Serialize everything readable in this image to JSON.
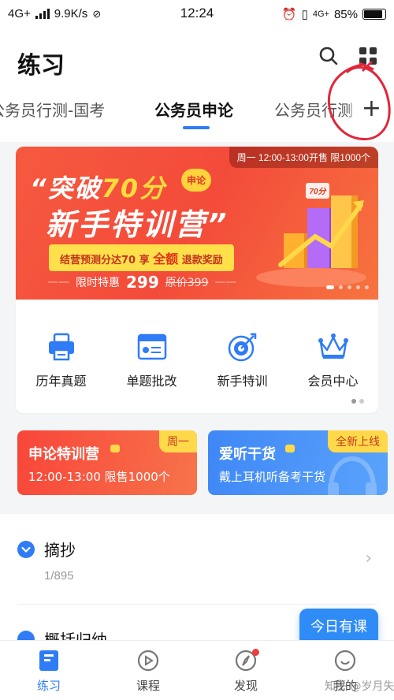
{
  "status_bar": {
    "network": "4G+",
    "speed": "9.9K/s",
    "time": "12:24",
    "network_right": "4G+",
    "battery": "85%"
  },
  "header": {
    "title": "练习",
    "tabs": [
      {
        "label": "公务员行测-国考",
        "active": false
      },
      {
        "label": "公务员申论",
        "active": true
      },
      {
        "label": "公务员行测",
        "active": false
      }
    ],
    "add_label": "+"
  },
  "banner": {
    "tag": "周一  12:00-13:00开售 限1000个",
    "line1_a": "“突破",
    "line1_b": "70分",
    "badge": "申论",
    "line2": "新手特训营”",
    "pill_a": "结营预测分达70  享",
    "pill_b": "全额",
    "pill_c": "退款奖励",
    "price_label": "限时特惠",
    "price": "299",
    "old_price": "原价399",
    "chart_label": "70分"
  },
  "quick_actions": [
    {
      "label": "历年真题",
      "icon": "printer-icon"
    },
    {
      "label": "单题批改",
      "icon": "document-icon"
    },
    {
      "label": "新手特训",
      "icon": "target-icon"
    },
    {
      "label": "会员中心",
      "icon": "crown-icon"
    }
  ],
  "promos": [
    {
      "title": "申论特训营",
      "subtitle": "12:00-13:00 限售1000个",
      "tag": "周一"
    },
    {
      "title": "爱听干货",
      "subtitle": "戴上耳机听备考干货",
      "tag": "全新上线"
    }
  ],
  "list": [
    {
      "title": "摘抄",
      "progress": "1/895"
    },
    {
      "title": "概括归纳"
    }
  ],
  "floating_button": "今日有课",
  "bottom_nav": [
    {
      "label": "练习",
      "active": true
    },
    {
      "label": "课程",
      "active": false
    },
    {
      "label": "发现",
      "active": false,
      "badge": true
    },
    {
      "label": "我的",
      "active": false
    }
  ],
  "watermark": "知乎 @岁月失语",
  "colors": {
    "accent": "#2f7cf6",
    "banner": "#f34b3a",
    "annotation": "#e0283a"
  }
}
